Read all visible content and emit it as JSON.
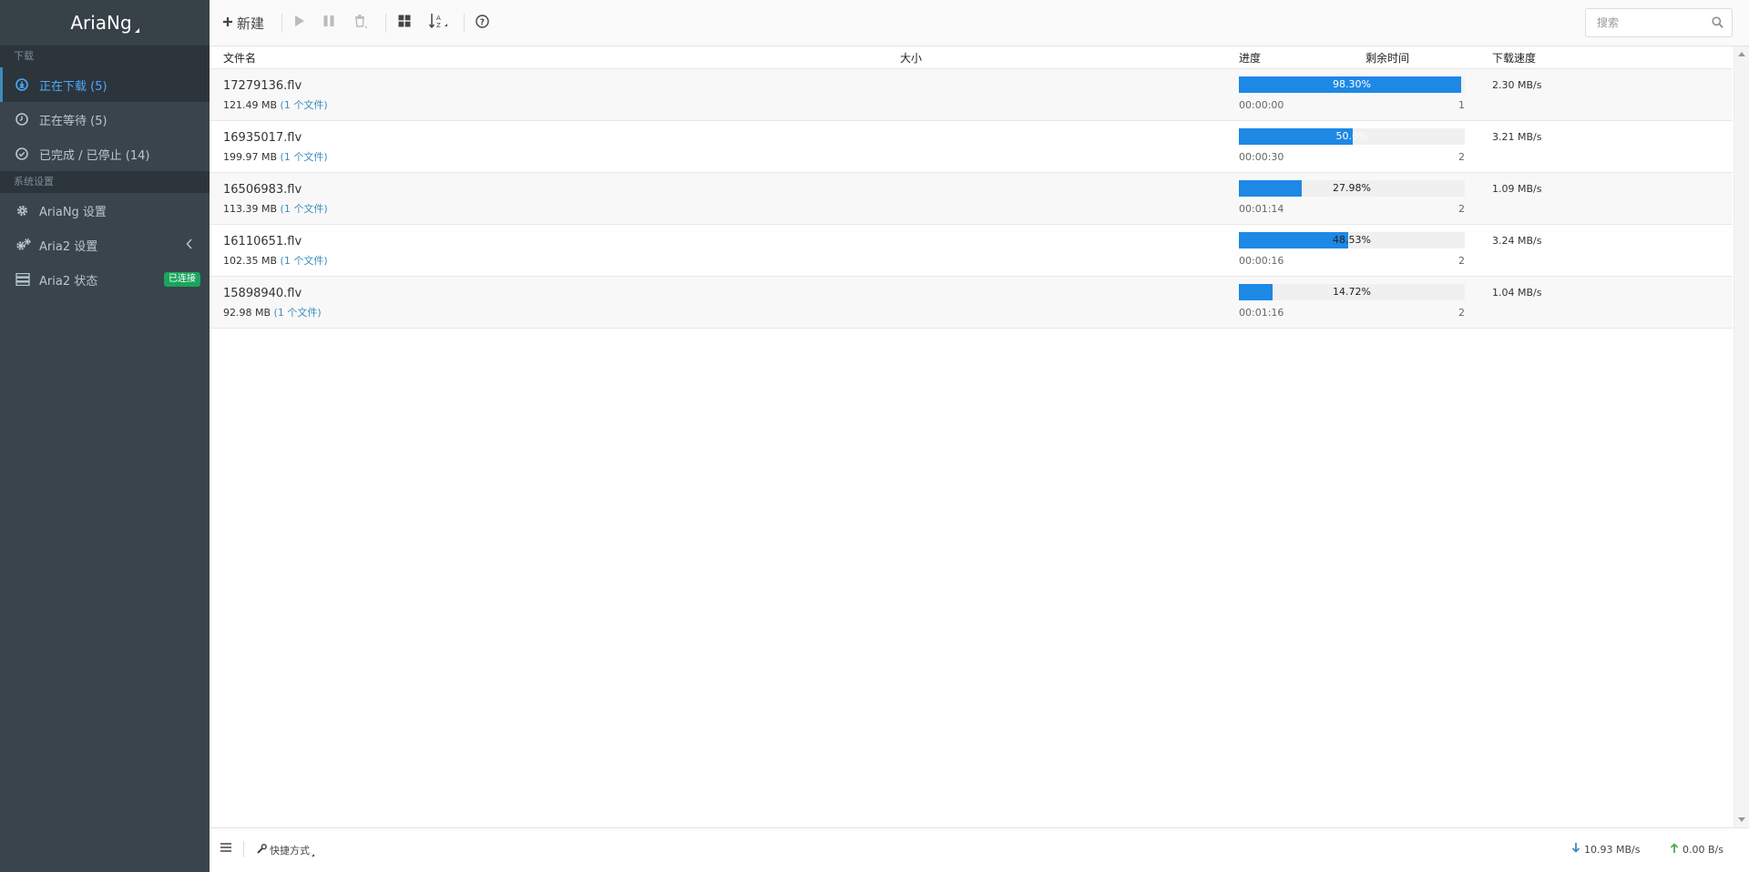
{
  "app": {
    "title": "AriaNg"
  },
  "sidebar": {
    "section_download": "下载",
    "items_download": [
      {
        "label": "正在下载 (5)",
        "icon": "download-circle-icon",
        "active": true
      },
      {
        "label": "正在等待 (5)",
        "icon": "clock-icon",
        "active": false
      },
      {
        "label": "已完成 / 已停止 (14)",
        "icon": "check-circle-icon",
        "active": false
      }
    ],
    "section_settings": "系统设置",
    "items_settings": [
      {
        "label": "AriaNg 设置",
        "icon": "gear-icon"
      },
      {
        "label": "Aria2 设置",
        "icon": "gears-icon"
      },
      {
        "label": "Aria2 状态",
        "icon": "server-icon",
        "badge": "已连接"
      }
    ]
  },
  "toolbar": {
    "new_label": "新建",
    "search_placeholder": "搜索"
  },
  "table": {
    "headers": {
      "name": "文件名",
      "size": "大小",
      "progress": "进度",
      "remaining": "剩余时间",
      "speed": "下载速度"
    },
    "rows": [
      {
        "name": "17279136.flv",
        "size": "121.49 MB",
        "files": "(1 个文件)",
        "progress": "98.30%",
        "percent": 98.3,
        "eta": "00:00:00",
        "connections": "1",
        "speed": "2.30 MB/s"
      },
      {
        "name": "16935017.flv",
        "size": "199.97 MB",
        "files": "(1 个文件)",
        "progress": "50.6%",
        "percent": 50.6,
        "eta": "00:00:30",
        "connections": "2",
        "speed": "3.21 MB/s"
      },
      {
        "name": "16506983.flv",
        "size": "113.39 MB",
        "files": "(1 个文件)",
        "progress": "27.98%",
        "percent": 27.98,
        "eta": "00:01:14",
        "connections": "2",
        "speed": "1.09 MB/s"
      },
      {
        "name": "16110651.flv",
        "size": "102.35 MB",
        "files": "(1 个文件)",
        "progress": "48.53%",
        "percent": 48.53,
        "eta": "00:00:16",
        "connections": "2",
        "speed": "3.24 MB/s"
      },
      {
        "name": "15898940.flv",
        "size": "92.98 MB",
        "files": "(1 个文件)",
        "progress": "14.72%",
        "percent": 14.72,
        "eta": "00:01:16",
        "connections": "2",
        "speed": "1.04 MB/s"
      }
    ]
  },
  "footer": {
    "shortcuts_label": "快捷方式",
    "download_speed": "10.93 MB/s",
    "upload_speed": "0.00 B/s"
  },
  "colors": {
    "accent": "#1e88e5",
    "sidebar_bg": "#3a444c",
    "connected_badge": "#1aa45c"
  }
}
